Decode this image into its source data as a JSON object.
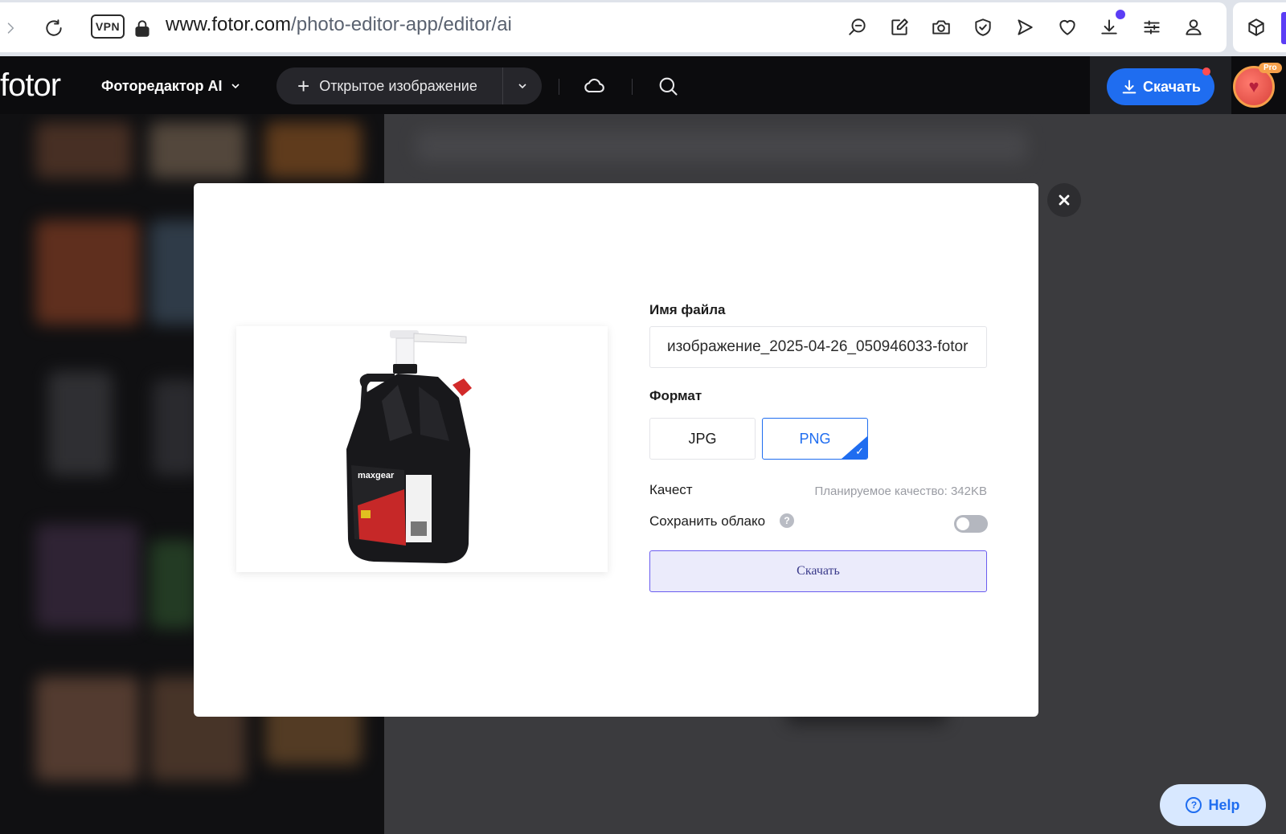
{
  "browser": {
    "vpn_label": "VPN",
    "url_host": "www.fotor.com",
    "url_path": "/photo-editor-app/editor/ai"
  },
  "header": {
    "logo": "fotor",
    "editor_menu_label": "Фоторедактор AI",
    "open_image_label": "Открытое изображение",
    "download_label": "Скачать",
    "pro_badge": "Pro"
  },
  "modal": {
    "filename_label": "Имя файла",
    "filename_value": "изображение_2025-04-26_050946033-fotor",
    "format_label": "Формат",
    "formats": [
      {
        "label": "JPG",
        "selected": false
      },
      {
        "label": "PNG",
        "selected": true
      }
    ],
    "quality_label": "Качест",
    "quality_note": "Планируемое качество: 342KB",
    "save_cloud_label": "Сохранить облако",
    "save_cloud_enabled": false,
    "download_label": "Скачать"
  },
  "help": {
    "label": "Help"
  },
  "colors": {
    "accent": "#1f6df0",
    "header_bg": "#0c0c0e",
    "modal_download_border": "#6a5cf0"
  },
  "icons": {
    "browser": [
      "chevron-right-icon",
      "reload-icon",
      "lock-icon",
      "zoom-search-icon",
      "edit-icon",
      "camera-icon",
      "shield-icon",
      "send-icon",
      "heart-icon",
      "download-icon",
      "settings-sliders-icon",
      "profile-icon",
      "cube-icon"
    ],
    "header": [
      "chevron-down-icon",
      "plus-icon",
      "cloud-icon",
      "search-icon",
      "download-icon"
    ],
    "modal": [
      "close-icon",
      "help-icon",
      "check-icon"
    ]
  }
}
